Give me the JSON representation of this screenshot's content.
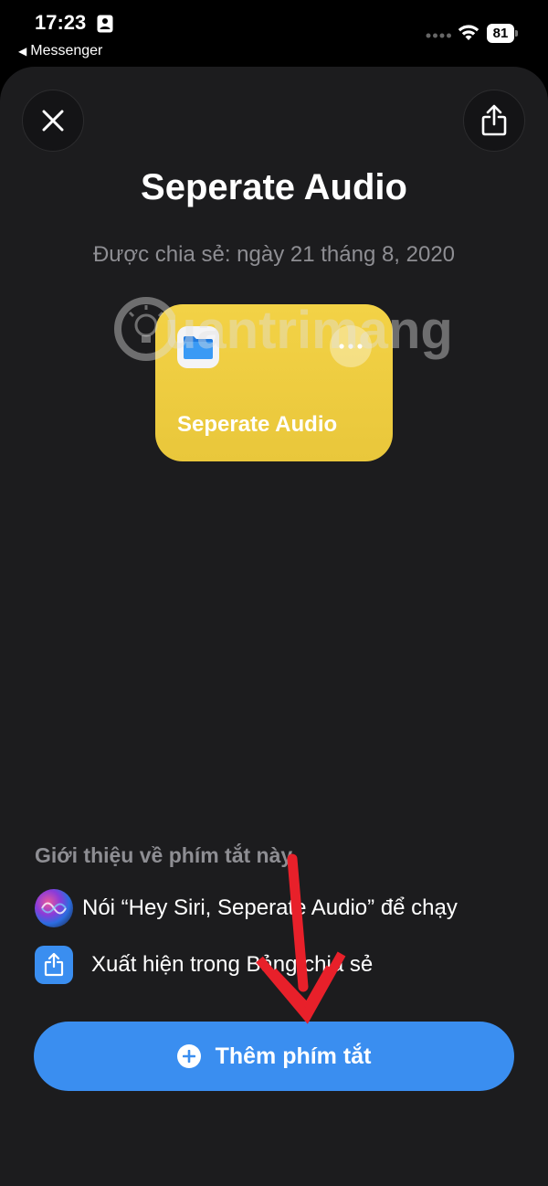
{
  "status_bar": {
    "time": "17:23",
    "back_app": "Messenger",
    "battery": "81"
  },
  "shortcut": {
    "title": "Seperate Audio",
    "shared_date": "Được chia sẻ: ngày 21 tháng 8, 2020",
    "card_name": "Seperate Audio",
    "card_color": "#EDCB3F"
  },
  "watermark": {
    "text": "uantrimang"
  },
  "about": {
    "heading": "Giới thiệu về phím tắt này",
    "items": [
      {
        "icon": "siri-icon",
        "text": "Nói “Hey Siri, Seperate Audio” để chạy"
      },
      {
        "icon": "share-sheet-icon",
        "text": "Xuất hiện trong Bảng chia sẻ"
      }
    ]
  },
  "add_button": {
    "label": "Thêm phím tắt",
    "color": "#3A8EF0"
  },
  "annotation": {
    "arrow_color": "#E8202A"
  }
}
